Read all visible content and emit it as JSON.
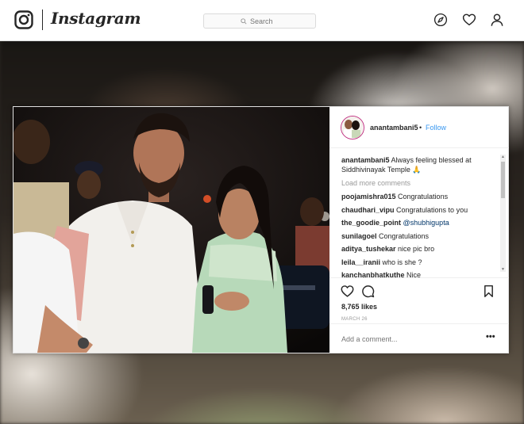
{
  "app": {
    "wordmark": "Instagram"
  },
  "search": {
    "placeholder": "Search"
  },
  "nav_icons": [
    "instagram-camera-icon",
    "compass-icon",
    "heart-icon",
    "profile-icon"
  ],
  "post": {
    "username": "anantambani5",
    "separator": "•",
    "follow_label": "Follow",
    "caption_user": "anantambani5",
    "caption_text": " Always feeling blessed at Siddhivinayak Temple 🙏",
    "load_more_label": "Load more comments",
    "comments": [
      {
        "user": "poojamishra015",
        "text": " Congratulations",
        "mention": ""
      },
      {
        "user": "chaudhari_vipu",
        "text": " Congratulations to you",
        "mention": ""
      },
      {
        "user": "the_goodie_point",
        "text": " ",
        "mention": "@shubhigupta"
      },
      {
        "user": "sunilagoel",
        "text": " Congratulations",
        "mention": ""
      },
      {
        "user": "aditya_tushekar",
        "text": " nice pic bro",
        "mention": ""
      },
      {
        "user": "leila__iranii",
        "text": " who is she ?",
        "mention": ""
      },
      {
        "user": "kanchanbhatkuthe",
        "text": " Nice",
        "mention": ""
      }
    ],
    "likes": "8,765 likes",
    "date": "MARCH 26",
    "add_comment_placeholder": "Add a comment...",
    "more_label": "•••"
  },
  "colors": {
    "link_blue": "#3897f0",
    "mention_blue": "#003569",
    "avatar_ring": "#c13584",
    "text": "#262626",
    "muted": "#999999"
  }
}
